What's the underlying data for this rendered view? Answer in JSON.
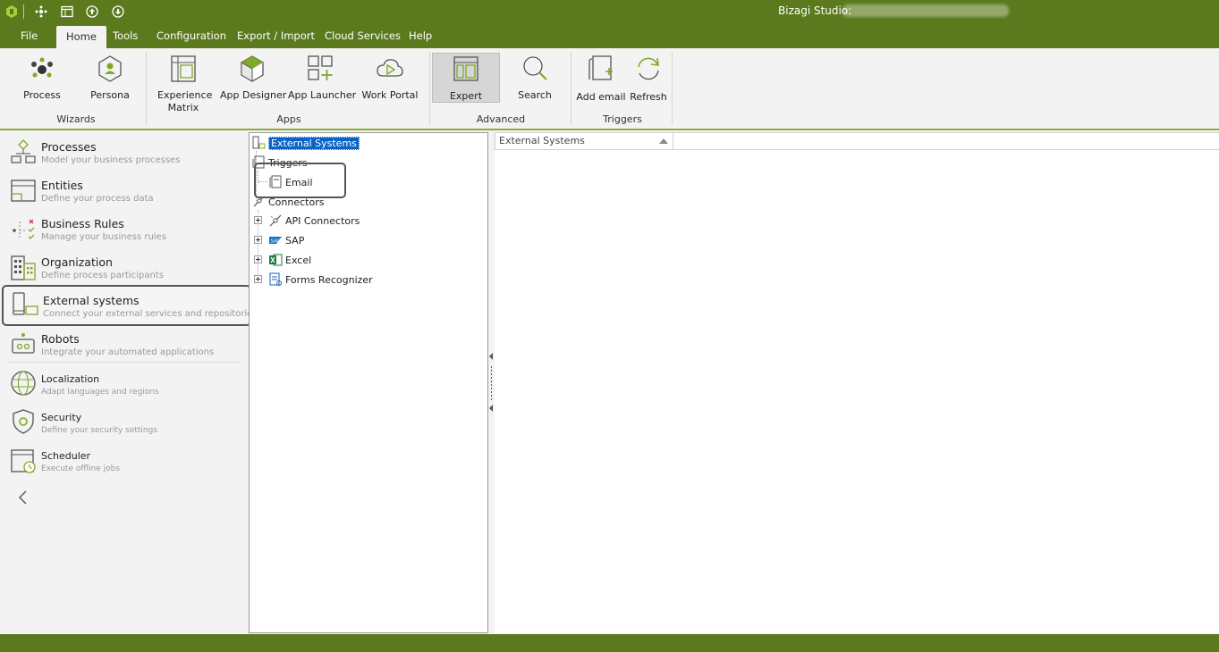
{
  "titlebar": {
    "title": "Bizagi Studio:",
    "quick_access_icons": [
      "bizagi-logo-icon",
      "network-icon",
      "window-icon",
      "upload-icon",
      "download-icon"
    ]
  },
  "menu": {
    "tabs": [
      {
        "label": "File",
        "active": false
      },
      {
        "label": "Home",
        "active": true
      },
      {
        "label": "Tools",
        "active": false
      },
      {
        "label": "Configuration",
        "active": false
      },
      {
        "label": "Export / Import",
        "active": false
      },
      {
        "label": "Cloud Services",
        "active": false
      },
      {
        "label": "Help",
        "active": false
      }
    ]
  },
  "ribbon": {
    "groups": [
      {
        "label": "Wizards",
        "buttons": [
          {
            "label": "Process",
            "icon": "process-icon"
          },
          {
            "label": "Persona",
            "icon": "persona-icon"
          }
        ]
      },
      {
        "label": "Apps",
        "buttons": [
          {
            "label": "Experience\nMatrix",
            "icon": "matrix-icon"
          },
          {
            "label": "App Designer",
            "icon": "app-designer-icon"
          },
          {
            "label": "App Launcher",
            "icon": "app-launcher-icon"
          },
          {
            "label": "Work Portal",
            "icon": "work-portal-icon"
          }
        ]
      },
      {
        "label": "Advanced",
        "buttons": [
          {
            "label": "Expert",
            "icon": "expert-icon",
            "selected": true
          },
          {
            "label": "Search",
            "icon": "search-icon"
          }
        ]
      },
      {
        "label": "Triggers",
        "buttons": [
          {
            "label": "Add email",
            "icon": "add-email-icon"
          },
          {
            "label": "Refresh",
            "icon": "refresh-icon"
          }
        ]
      }
    ]
  },
  "nav": {
    "items": [
      {
        "title": "Processes",
        "desc": "Model your business processes",
        "icon": "processes-icon"
      },
      {
        "title": "Entities",
        "desc": "Define your process data",
        "icon": "entities-icon"
      },
      {
        "title": "Business Rules",
        "desc": "Manage your business rules",
        "icon": "business-rules-icon"
      },
      {
        "title": "Organization",
        "desc": "Define process participants",
        "icon": "organization-icon"
      },
      {
        "title": "External systems",
        "desc": "Connect your external services and repositories",
        "icon": "external-systems-icon",
        "highlighted": true
      },
      {
        "title": "Robots",
        "desc": "Integrate your automated applications",
        "icon": "robots-icon"
      },
      {
        "title": "Localization",
        "desc": "Adapt languages and regions",
        "icon": "globe-icon"
      },
      {
        "title": "Security",
        "desc": "Define your security settings",
        "icon": "shield-icon"
      },
      {
        "title": "Scheduler",
        "desc": "Execute offline jobs",
        "icon": "calendar-clock-icon"
      }
    ]
  },
  "tree": {
    "root": "External Systems",
    "triggers": "Triggers",
    "email": "Email",
    "connectors": "Connectors",
    "connector_children": [
      "API Connectors",
      "SAP",
      "Excel",
      "Forms Recognizer"
    ]
  },
  "grid": {
    "column": "External Systems"
  },
  "colors": {
    "brand_green": "#5b7a1d",
    "accent_green": "#8cab3b",
    "selection_blue": "#0a64c8"
  }
}
